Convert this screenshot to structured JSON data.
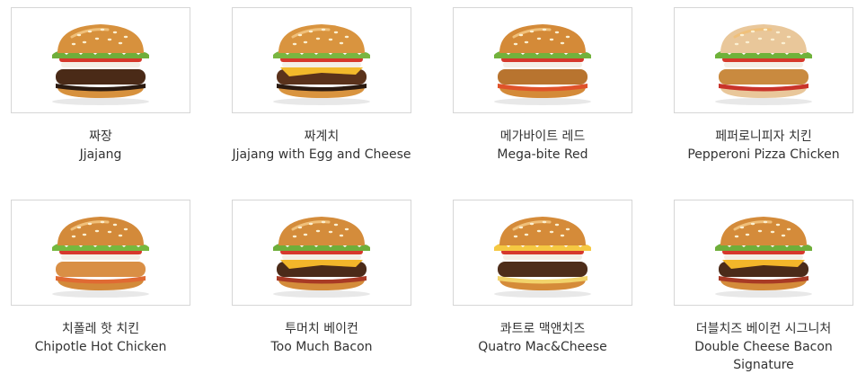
{
  "menu": {
    "items": [
      {
        "ko": "짜장",
        "en": "Jjajang",
        "icon": "burger-jjajang-icon",
        "bun": "#d7913d",
        "patty": "#4a2a17",
        "sauce": "#2b1a10",
        "veg": "#6fae3a"
      },
      {
        "ko": "짜계치",
        "en": "Jjajang with Egg and Cheese",
        "icon": "burger-egg-cheese-icon",
        "bun": "#d9943f",
        "patty": "#5a321b",
        "sauce": "#2b1a10",
        "veg": "#79b640",
        "cheese": "#f2b92b"
      },
      {
        "ko": "메가바이트 레드",
        "en": "Mega-bite Red",
        "icon": "burger-megabite-red-icon",
        "bun": "#d48a38",
        "patty": "#b8742f",
        "sauce": "#e0522a",
        "veg": "#72b23c"
      },
      {
        "ko": "페퍼로니피자 치킨",
        "en": "Pepperoni Pizza Chicken",
        "icon": "burger-pepperoni-chicken-icon",
        "bun": "#e9c79a",
        "patty": "#c98a3f",
        "sauce": "#c9332a",
        "veg": "#6fb23a"
      },
      {
        "ko": "치폴레 핫 치킨",
        "en": "Chipotle Hot Chicken",
        "icon": "burger-chipotle-chicken-icon",
        "bun": "#d38a3a",
        "patty": "#d98f45",
        "sauce": "#e06a33",
        "veg": "#76b83e"
      },
      {
        "ko": "투머치 베이컨",
        "en": "Too Much Bacon",
        "icon": "burger-bacon-icon",
        "bun": "#d48c3b",
        "patty": "#4b2b19",
        "sauce": "#a83a25",
        "veg": "#6fae3a",
        "cheese": "#f3b62a"
      },
      {
        "ko": "콰트로 맥앤치즈",
        "en": "Quatro Mac&Cheese",
        "icon": "burger-mac-cheese-icon",
        "bun": "#d58b39",
        "patty": "#4e2d1a",
        "sauce": "#f2d36b",
        "veg": "#f5c842"
      },
      {
        "ko": "더블치즈 베이컨 시그니처",
        "en": "Double Cheese Bacon Signature",
        "icon": "burger-double-cheese-bacon-icon",
        "bun": "#d48b3a",
        "patty": "#4b2b19",
        "sauce": "#a83a25",
        "veg": "#6fae3a",
        "cheese": "#f3b62a"
      }
    ]
  }
}
